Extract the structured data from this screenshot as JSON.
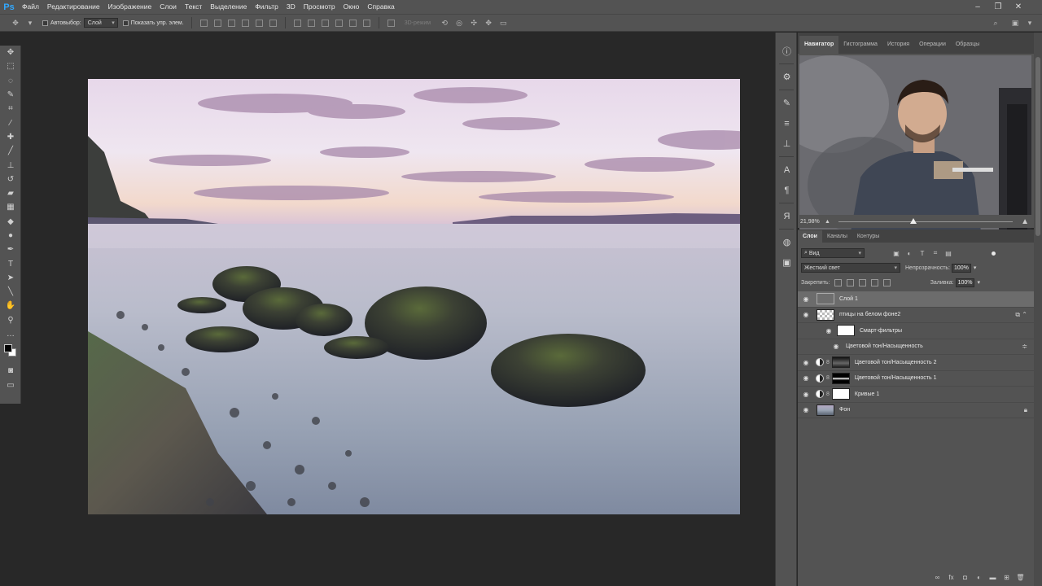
{
  "app": {
    "logo": "Ps",
    "menu": [
      "Файл",
      "Редактирование",
      "Изображение",
      "Слои",
      "Текст",
      "Выделение",
      "Фильтр",
      "3D",
      "Просмотр",
      "Окно",
      "Справка"
    ]
  },
  "options_bar": {
    "autoselect_label": "Автовыбор:",
    "autoselect_value": "Слой",
    "show_controls_label": "Показать упр. элем.",
    "mode_3d_label": "3D-режим"
  },
  "navigator": {
    "tabs": [
      "Навигатор",
      "Гистограмма",
      "История",
      "Операции",
      "Образцы"
    ],
    "active_tab": "Навигатор",
    "zoom": "21,98%",
    "zoom_position": 0.43
  },
  "layers_panel": {
    "tabs": [
      "Слои",
      "Каналы",
      "Контуры"
    ],
    "active_tab": "Слои",
    "kind_filter": "Вид",
    "blend_mode": "Жесткий свет",
    "opacity_label": "Непрозрачность:",
    "opacity_value": "100%",
    "lock_label": "Закрепить:",
    "fill_label": "Заливка:",
    "fill_value": "100%",
    "layers": [
      {
        "name": "Слой 1"
      },
      {
        "name": "птицы на белом фоне2"
      },
      {
        "name": "Смарт-фильтры"
      },
      {
        "name": "Цветовой тон/Насыщенность"
      },
      {
        "name": "Цветовой тон/Насыщенность 2"
      },
      {
        "name": "Цветовой тон/Насыщенность 1"
      },
      {
        "name": "Кривые 1"
      },
      {
        "name": "Фон"
      }
    ]
  }
}
